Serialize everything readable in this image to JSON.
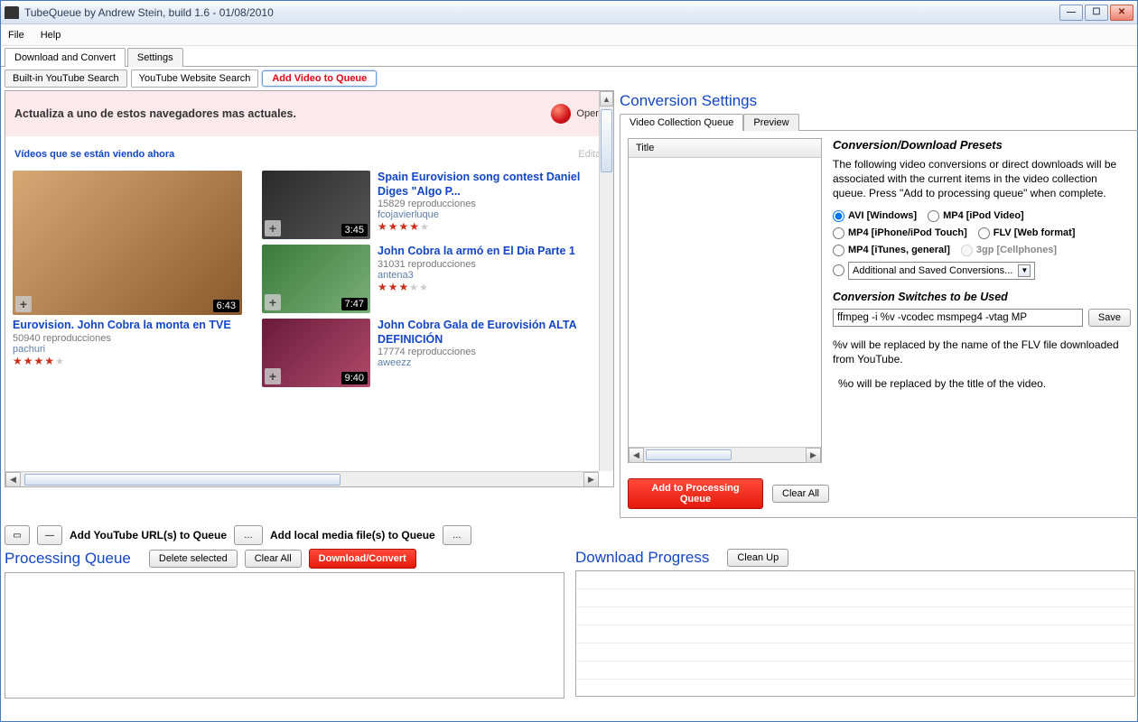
{
  "window": {
    "title": "TubeQueue by Andrew Stein, build 1.6 - 01/08/2010"
  },
  "menu": {
    "file": "File",
    "help": "Help"
  },
  "tabs": {
    "download": "Download and Convert",
    "settings": "Settings"
  },
  "subtabs": {
    "builtin": "Built-in YouTube Search",
    "website": "YouTube Website Search",
    "addvideo": "Add Video to Queue"
  },
  "yt": {
    "banner_msg": "Actualiza a uno de estos navegadores mas actuales.",
    "opera": "Opera",
    "heading": "Vídeos que se están viendo ahora",
    "editar": "Editar",
    "videos": {
      "left": {
        "title": "Eurovision. John Cobra la monta en TVE",
        "views": "50940 reproducciones",
        "user": "pachuri",
        "stars": 4,
        "dur": "6:43"
      },
      "r1": {
        "title": "Spain Eurovision song contest Daniel Diges \"Algo P...",
        "views": "15829 reproducciones",
        "user": "fcojavierluque",
        "stars": 4,
        "dur": "3:45"
      },
      "r2": {
        "title": "John Cobra la armó en El Dia Parte 1",
        "views": "31031 reproducciones",
        "user": "antena3",
        "stars": 3,
        "dur": "7:47"
      },
      "r3": {
        "title": "John Cobra Gala de Eurovisión ALTA DEFINICIÓN",
        "views": "17774 reproducciones",
        "user": "aweezz",
        "stars": 0,
        "dur": "9:40"
      }
    }
  },
  "conv": {
    "heading": "Conversion Settings",
    "tab_queue": "Video Collection Queue",
    "tab_preview": "Preview",
    "queue_title": "Title",
    "presets_heading": "Conversion/Download Presets",
    "presets_text": "The following video conversions or direct downloads will be associated with the current items in the video collection queue. Press \"Add to processing queue\" when complete.",
    "fmt": {
      "avi": "AVI [Windows]",
      "mp4ipod": "MP4 [iPod Video]",
      "mp4iphone": "MP4 [iPhone/iPod Touch]",
      "flv": "FLV [Web format]",
      "mp4itunes": "MP4 [iTunes, general]",
      "threegp": "3gp [Cellphones]",
      "additional": "Additional and Saved Conversions..."
    },
    "switches_heading": "Conversion Switches to be Used",
    "switches_value": "ffmpeg -i %v -vcodec msmpeg4 -vtag MP",
    "save": "Save",
    "help1": "%v will be replaced by the name of the FLV file downloaded from YouTube.",
    "help2": "%o will be replaced by the title of the video.",
    "add_process": "Add to Processing Queue",
    "clear_all": "Clear All"
  },
  "urlrow": {
    "add_url": "Add YouTube URL(s) to Queue",
    "add_local": "Add local media file(s) to Queue"
  },
  "proc": {
    "heading": "Processing Queue",
    "delete": "Delete selected",
    "clear": "Clear All",
    "dlconv": "Download/Convert"
  },
  "dl": {
    "heading": "Download Progress",
    "cleanup": "Clean Up"
  }
}
